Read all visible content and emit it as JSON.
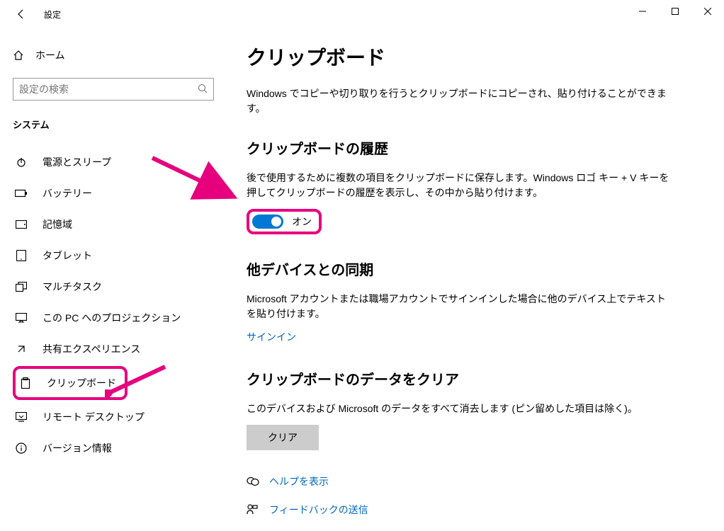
{
  "titlebar": {
    "title": "設定"
  },
  "sidebar": {
    "home": "ホーム",
    "search_placeholder": "設定の検索",
    "section": "システム",
    "items": [
      {
        "label": "電源とスリープ"
      },
      {
        "label": "バッテリー"
      },
      {
        "label": "記憶域"
      },
      {
        "label": "タブレット"
      },
      {
        "label": "マルチタスク"
      },
      {
        "label": "この PC へのプロジェクション"
      },
      {
        "label": "共有エクスペリエンス"
      },
      {
        "label": "クリップボード"
      },
      {
        "label": "リモート デスクトップ"
      },
      {
        "label": "バージョン情報"
      }
    ]
  },
  "main": {
    "title": "クリップボード",
    "intro": "Windows でコピーや切り取りを行うとクリップボードにコピーされ、貼り付けることができます。",
    "history": {
      "title": "クリップボードの履歴",
      "desc": "後で使用するために複数の項目をクリップボードに保存します。Windows ロゴ キー + V キーを押してクリップボードの履歴を表示し、その中から貼り付けます。",
      "toggle_label": "オン"
    },
    "sync": {
      "title": "他デバイスとの同期",
      "desc": "Microsoft アカウントまたは職場アカウントでサインインした場合に他のデバイス上でテキストを貼り付けます。",
      "signin_link": "サインイン"
    },
    "clear": {
      "title": "クリップボードのデータをクリア",
      "desc": "このデバイスおよび Microsoft のデータをすべて消去します (ピン留めした項目は除く)。",
      "button": "クリア"
    },
    "footer": {
      "help": "ヘルプを表示",
      "feedback": "フィードバックの送信"
    }
  }
}
